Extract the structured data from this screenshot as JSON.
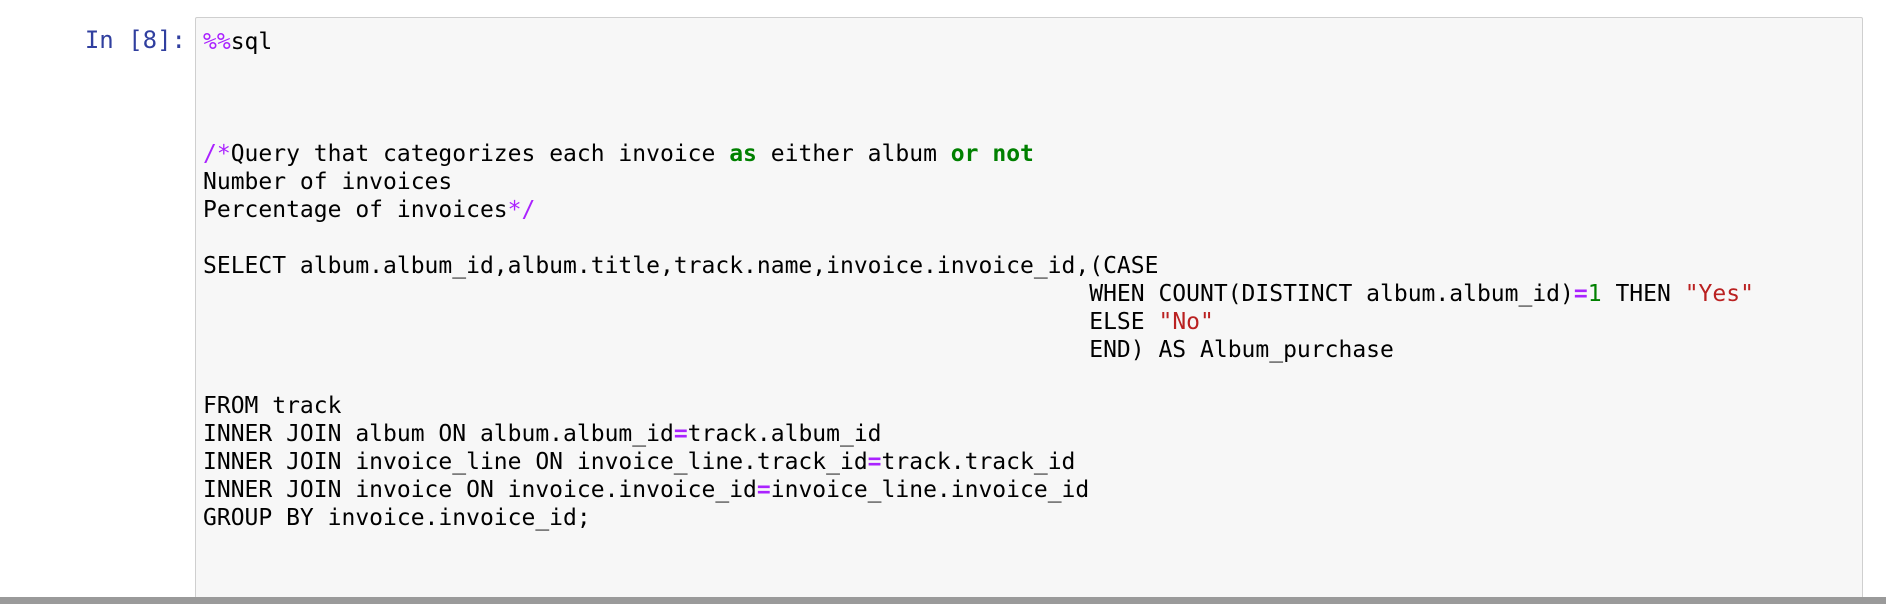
{
  "cell": {
    "prompt": "In [8]:",
    "lines": [
      [
        {
          "t": "%%",
          "c": "magic"
        },
        {
          "t": "sql",
          "c": "plain"
        }
      ],
      [],
      [],
      [],
      [
        {
          "t": "/*",
          "c": "comment-delim"
        },
        {
          "t": "Query that categorizes each invoice ",
          "c": "plain"
        },
        {
          "t": "as",
          "c": "kw"
        },
        {
          "t": " either album ",
          "c": "plain"
        },
        {
          "t": "or",
          "c": "kw"
        },
        {
          "t": " ",
          "c": "plain"
        },
        {
          "t": "not",
          "c": "kw"
        }
      ],
      [
        {
          "t": "Number of invoices",
          "c": "plain"
        }
      ],
      [
        {
          "t": "Percentage of invoices",
          "c": "plain"
        },
        {
          "t": "*/",
          "c": "comment-delim"
        }
      ],
      [],
      [
        {
          "t": "SELECT album.album_id,album.title,track.name,invoice.invoice_id,(CASE",
          "c": "plain"
        }
      ],
      [
        {
          "t": "                                                                WHEN COUNT(DISTINCT album.album_id)",
          "c": "plain"
        },
        {
          "t": "=",
          "c": "op"
        },
        {
          "t": "1",
          "c": "num"
        },
        {
          "t": " THEN ",
          "c": "plain"
        },
        {
          "t": "\"Yes\"",
          "c": "str"
        }
      ],
      [
        {
          "t": "                                                                ELSE ",
          "c": "plain"
        },
        {
          "t": "\"No\"",
          "c": "str"
        }
      ],
      [
        {
          "t": "                                                                END) AS Album_purchase",
          "c": "plain"
        }
      ],
      [],
      [
        {
          "t": "FROM track",
          "c": "plain"
        }
      ],
      [
        {
          "t": "INNER JOIN album ON album.album_id",
          "c": "plain"
        },
        {
          "t": "=",
          "c": "op"
        },
        {
          "t": "track.album_id",
          "c": "plain"
        }
      ],
      [
        {
          "t": "INNER JOIN invoice_line ON invoice_line.track_id",
          "c": "plain"
        },
        {
          "t": "=",
          "c": "op"
        },
        {
          "t": "track.track_id",
          "c": "plain"
        }
      ],
      [
        {
          "t": "INNER JOIN invoice ON invoice.invoice_id",
          "c": "plain"
        },
        {
          "t": "=",
          "c": "op"
        },
        {
          "t": "invoice_line.invoice_id",
          "c": "plain"
        }
      ],
      [
        {
          "t": "GROUP BY invoice.invoice_id;",
          "c": "plain"
        }
      ]
    ]
  },
  "colors": {
    "prompt": "#303F9F",
    "magic": "#AA22FF",
    "keyword": "#008000",
    "operator": "#AA22FF",
    "number": "#008000",
    "string": "#BA2121",
    "cell_background": "#f7f7f7",
    "cell_border": "#cfcfcf"
  }
}
